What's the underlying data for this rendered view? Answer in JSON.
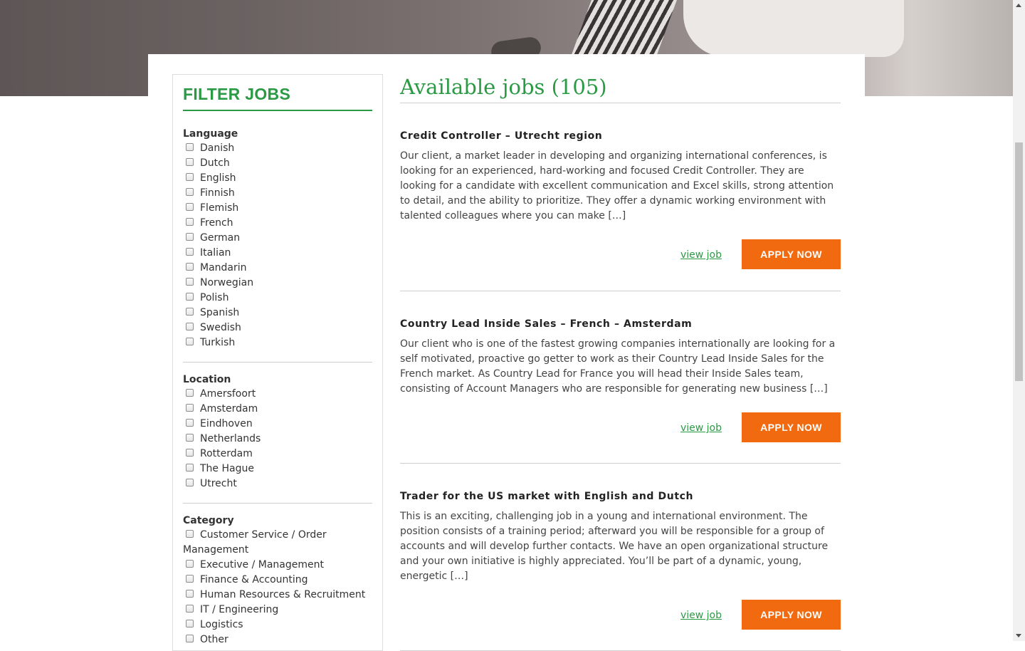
{
  "colors": {
    "accent_green": "#2a9a45",
    "apply_orange": "#f26a10"
  },
  "sidebar": {
    "title": "FILTER JOBS",
    "groups": [
      {
        "title": "Language",
        "options": [
          "Danish",
          "Dutch",
          "English",
          "Finnish",
          "Flemish",
          "French",
          "German",
          "Italian",
          "Mandarin",
          "Norwegian",
          "Polish",
          "Spanish",
          "Swedish",
          "Turkish"
        ]
      },
      {
        "title": "Location",
        "options": [
          "Amersfoort",
          "Amsterdam",
          "Eindhoven",
          "Netherlands",
          "Rotterdam",
          "The Hague",
          "Utrecht"
        ]
      },
      {
        "title": "Category",
        "options": [
          "Customer Service / Order Management",
          "Executive / Management",
          "Finance & Accounting",
          "Human Resources & Recruitment",
          "IT / Engineering",
          "Logistics",
          "Other"
        ]
      }
    ]
  },
  "main": {
    "title": "Available jobs (105)",
    "jobs": [
      {
        "title": "Credit Controller – Utrecht region",
        "description": "Our client, a market leader in developing and organizing international conferences, is looking for an experienced, hard-working and focused Credit Controller. They are looking for a candidate with excellent communication and Excel skills, strong attention to detail, and the ability to prioritize. They offer a dynamic working environment with talented colleagues where you can make […]",
        "view_label": "view job",
        "apply_label": "APPLY NOW"
      },
      {
        "title": "Country Lead Inside Sales – French – Amsterdam",
        "description": "Our client who is one of the fastest growing companies internationally are looking for a self motivated, proactive go getter to work as their Country Lead Inside Sales for the French market. As Country Lead for France you will head their Inside Sales team, consisting of Account Managers who are responsible for generating new business […]",
        "view_label": "view job",
        "apply_label": "APPLY NOW"
      },
      {
        "title": "Trader for the US market with English and Dutch",
        "description": "This is an exciting, challenging job in a young and international environment. The position consists of a training period; afterward you will be responsible for a group of accounts and will develop further contacts. We have an open organizational structure and your own initiative is highly appreciated. You’ll be part of a dynamic, young, energetic […]",
        "view_label": "view job",
        "apply_label": "APPLY NOW"
      }
    ]
  }
}
